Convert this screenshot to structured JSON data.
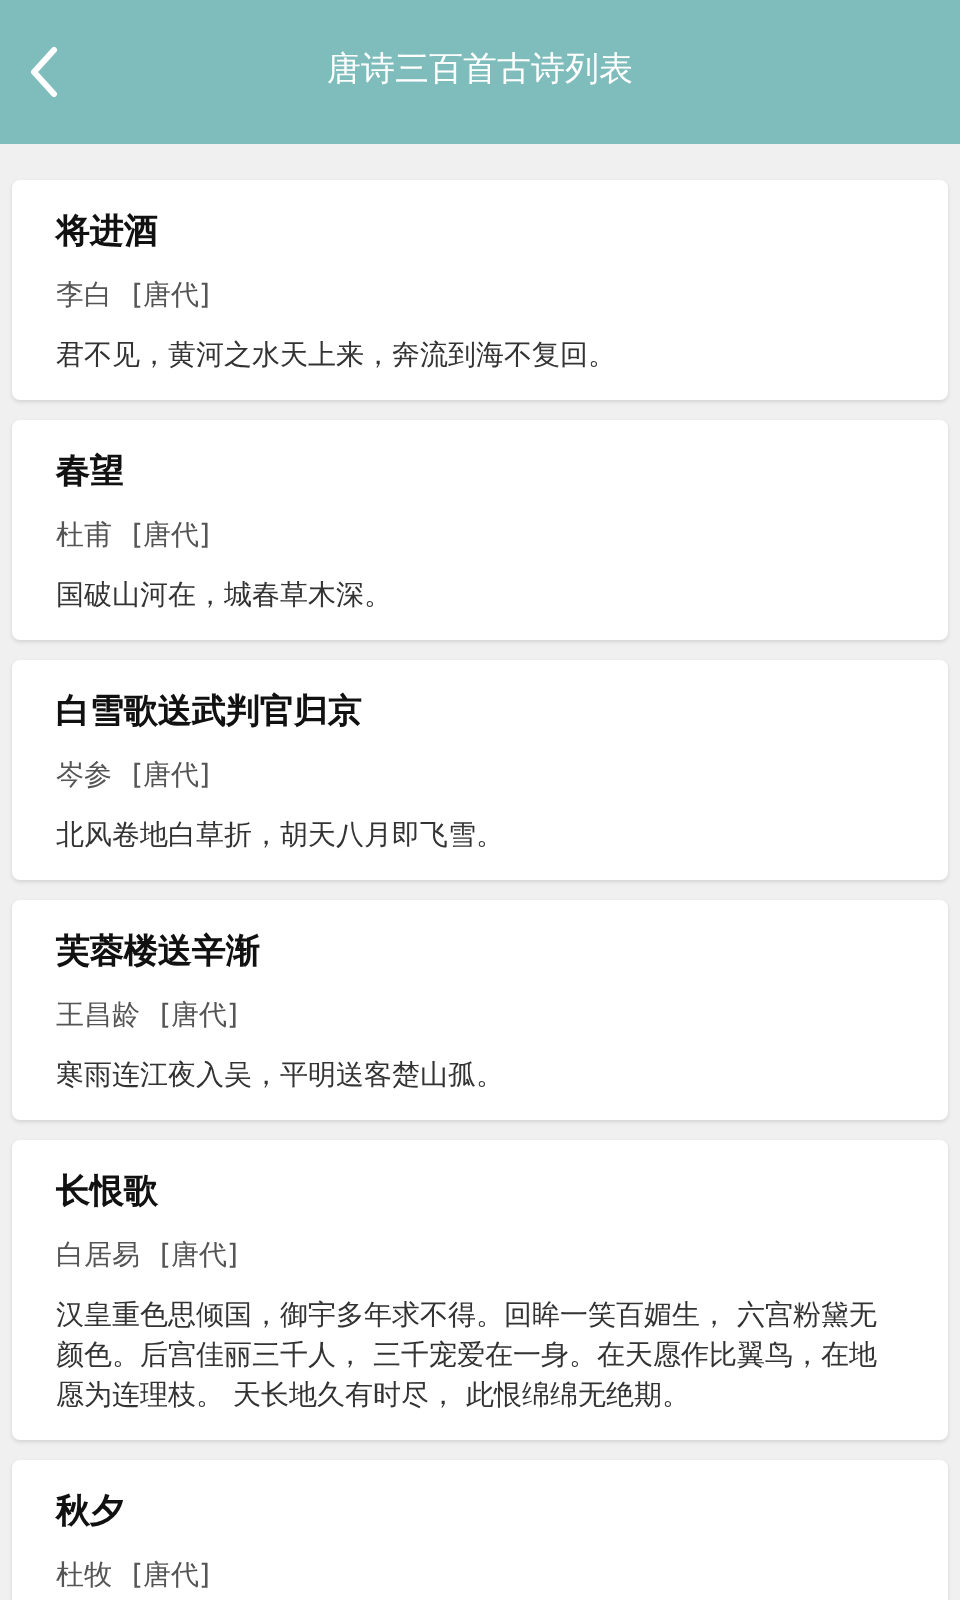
{
  "header": {
    "title": "唐诗三百首古诗列表"
  },
  "poems": [
    {
      "title": "将进酒",
      "author": "李白",
      "dynasty": "[唐代]",
      "verse": "君不见，黄河之水天上来，奔流到海不复回。"
    },
    {
      "title": "春望",
      "author": "杜甫",
      "dynasty": "[唐代]",
      "verse": "国破山河在，城春草木深。"
    },
    {
      "title": "白雪歌送武判官归京",
      "author": "岑参",
      "dynasty": "[唐代]",
      "verse": "北风卷地白草折，胡天八月即飞雪。"
    },
    {
      "title": "芙蓉楼送辛渐",
      "author": "王昌龄",
      "dynasty": "[唐代]",
      "verse": "寒雨连江夜入吴，平明送客楚山孤。"
    },
    {
      "title": "长恨歌",
      "author": "白居易",
      "dynasty": "[唐代]",
      "verse": "汉皇重色思倾国，御宇多年求不得。回眸一笑百媚生， 六宫粉黛无颜色。后宫佳丽三千人， 三千宠爱在一身。在天愿作比翼鸟，在地愿为连理枝。 天长地久有时尽， 此恨绵绵无绝期。"
    },
    {
      "title": "秋夕",
      "author": "杜牧",
      "dynasty": "[唐代]"
    }
  ]
}
